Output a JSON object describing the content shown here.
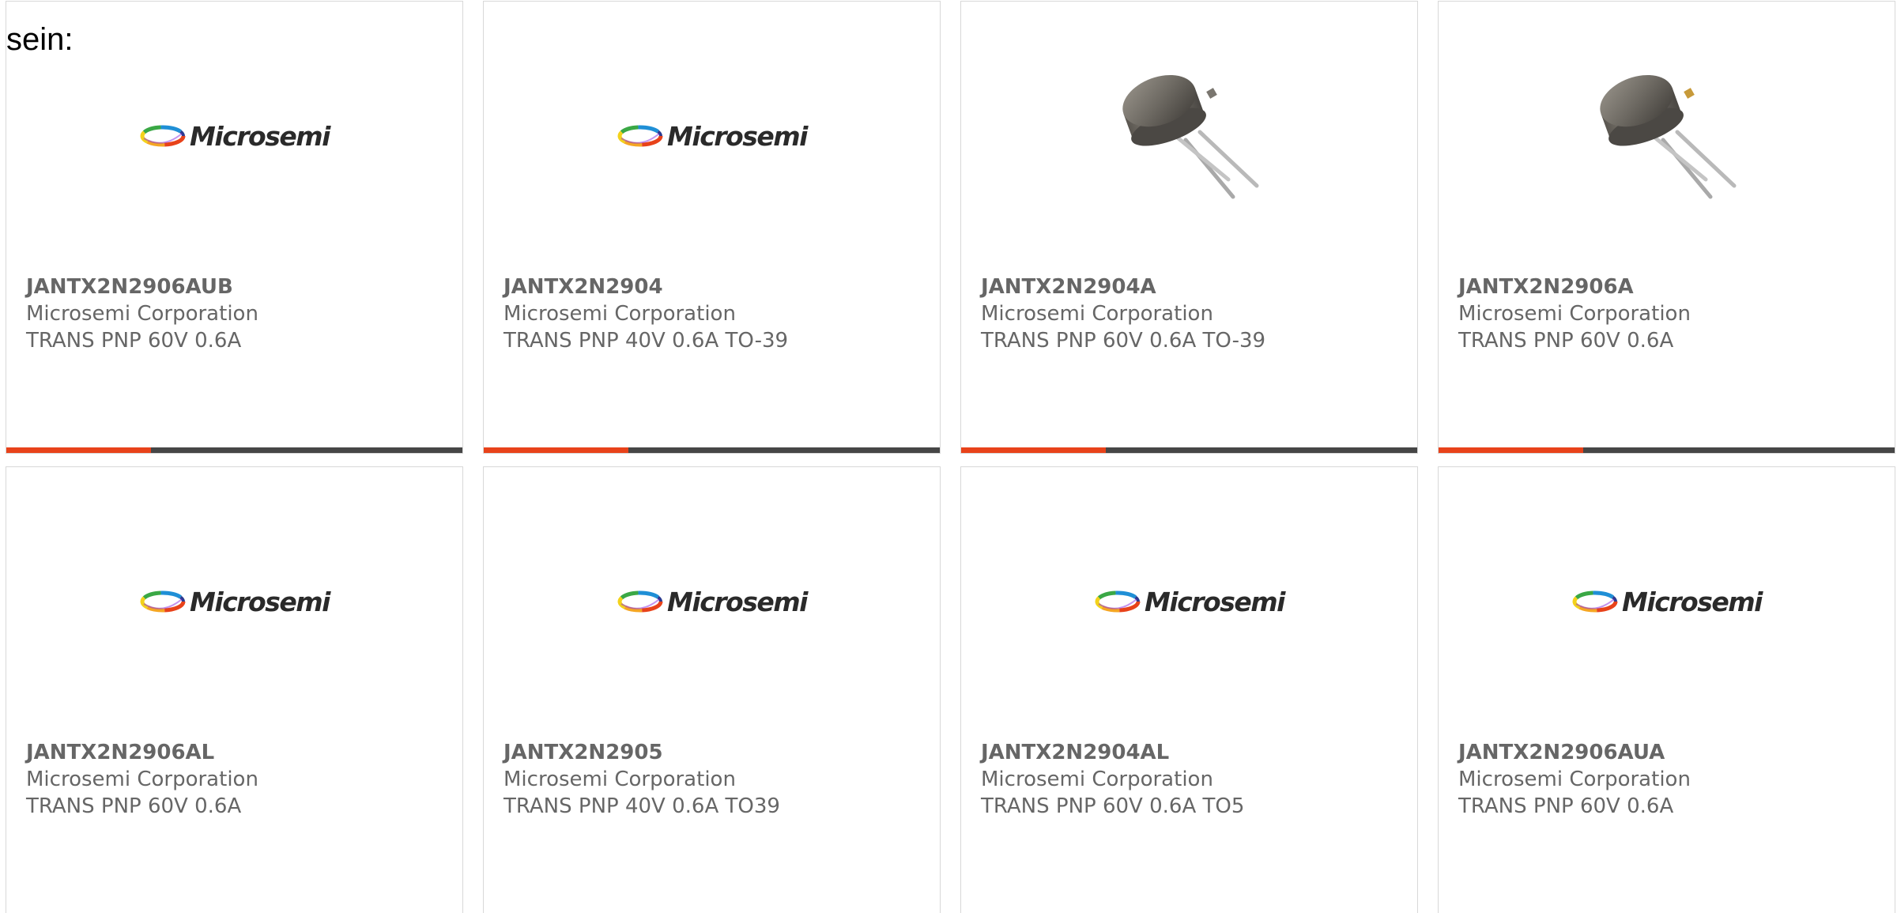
{
  "intro_text": "sein:",
  "brand": {
    "logo_text": "Microsemi"
  },
  "colors": {
    "accent_bar": "#e8421a",
    "dark_bar": "#464646",
    "text": "#666666"
  },
  "products": [
    {
      "part_number": "JANTX2N2906AUB",
      "manufacturer": "Microsemi Corporation",
      "description": "TRANS PNP 60V 0.6A",
      "image": "microsemi-logo"
    },
    {
      "part_number": "JANTX2N2904",
      "manufacturer": "Microsemi Corporation",
      "description": "TRANS PNP 40V 0.6A TO-39",
      "image": "microsemi-logo"
    },
    {
      "part_number": "JANTX2N2904A",
      "manufacturer": "Microsemi Corporation",
      "description": "TRANS PNP 60V 0.6A TO-39",
      "image": "to39-transistor-photo"
    },
    {
      "part_number": "JANTX2N2906A",
      "manufacturer": "Microsemi Corporation",
      "description": "TRANS PNP 60V 0.6A",
      "image": "to39-transistor-photo-tab"
    },
    {
      "part_number": "JANTX2N2906AL",
      "manufacturer": "Microsemi Corporation",
      "description": "TRANS PNP 60V 0.6A",
      "image": "microsemi-logo"
    },
    {
      "part_number": "JANTX2N2905",
      "manufacturer": "Microsemi Corporation",
      "description": "TRANS PNP 40V 0.6A TO39",
      "image": "microsemi-logo"
    },
    {
      "part_number": "JANTX2N2904AL",
      "manufacturer": "Microsemi Corporation",
      "description": "TRANS PNP 60V 0.6A TO5",
      "image": "microsemi-logo"
    },
    {
      "part_number": "JANTX2N2906AUA",
      "manufacturer": "Microsemi Corporation",
      "description": "TRANS PNP 60V 0.6A",
      "image": "microsemi-logo"
    }
  ]
}
